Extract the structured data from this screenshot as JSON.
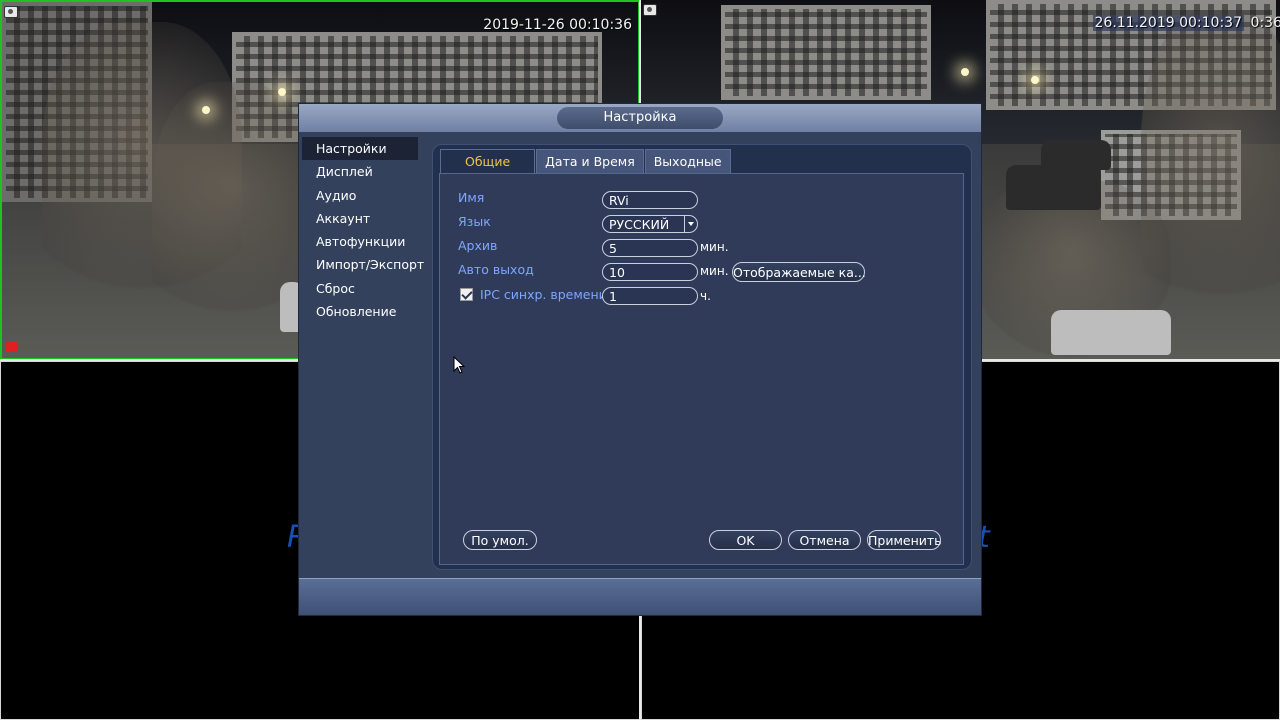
{
  "cameras": {
    "cam1_timestamp": "2019-11-26 00:10:36",
    "cam2_timestamp": "26.11.2019 00:10:37",
    "cam2_timestamp_overlap": "0:36",
    "background_text_left": "R",
    "background_text_right": "t"
  },
  "dialog": {
    "title": "Настройка",
    "menu": [
      {
        "label": "Настройки",
        "active": true
      },
      {
        "label": "Дисплей"
      },
      {
        "label": "Аудио"
      },
      {
        "label": "Аккаунт"
      },
      {
        "label": "Автофункции"
      },
      {
        "label": "Импорт/Экспорт"
      },
      {
        "label": "Сброс"
      },
      {
        "label": "Обновление"
      }
    ],
    "tabs": [
      {
        "label": "Общие",
        "active": true
      },
      {
        "label": "Дата и Время"
      },
      {
        "label": "Выходные"
      }
    ],
    "form": {
      "name_label": "Имя",
      "name_value": "RVi",
      "language_label": "Язык",
      "language_value": "РУССКИЙ",
      "archive_label": "Архив",
      "archive_value": "5",
      "archive_unit": "мин.",
      "autologout_label": "Авто выход",
      "autologout_value": "10",
      "autologout_unit": "мин.",
      "displayed_button": "Отображаемые ка...",
      "ipc_sync_label": "IPC синхр. времени",
      "ipc_sync_checked": true,
      "ipc_sync_value": "1",
      "ipc_sync_unit": "ч."
    },
    "buttons": {
      "default": "По умол.",
      "ok": "OK",
      "cancel": "Отмена",
      "apply": "Применить"
    }
  }
}
